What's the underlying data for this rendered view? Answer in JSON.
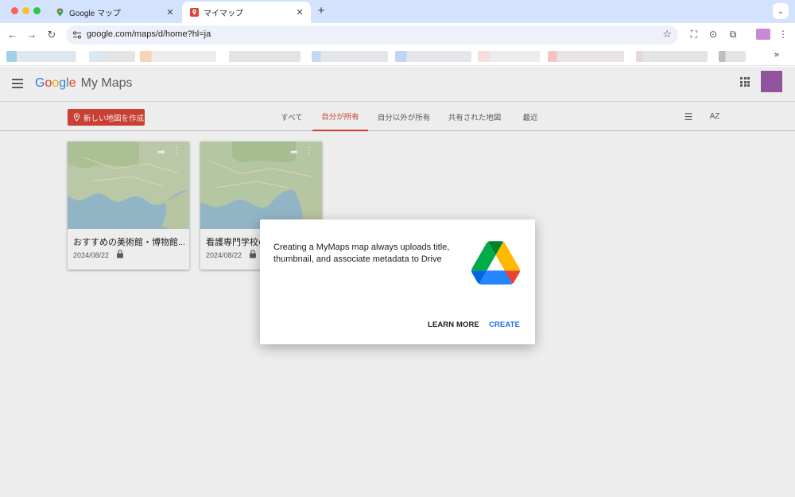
{
  "browser": {
    "tabs": [
      {
        "title": "Google マップ",
        "close": "✕"
      },
      {
        "title": "マイマップ",
        "close": "✕"
      }
    ],
    "new_tab": "+",
    "tab_menu": "⌄",
    "url": "google.com/maps/d/home?hl=ja",
    "bookmarks_more": "»"
  },
  "app": {
    "logo": {
      "g1": "G",
      "g2": "o",
      "g3": "o",
      "g4": "g",
      "g5": "l",
      "g6": "e",
      "product": "My Maps"
    },
    "create_button": "新しい地図を作成",
    "tabs": [
      "すべて",
      "自分が所有",
      "自分以外が所有",
      "共有された地図",
      "最近"
    ],
    "active_tab": "自分が所有",
    "sort_icon": "AZ"
  },
  "maps": [
    {
      "title": "おすすめの美術館・博物館...",
      "date": "2024/08/22"
    },
    {
      "title": "看護専門学校の",
      "date": "2024/08/22"
    }
  ],
  "dialog": {
    "message": "Creating a MyMaps map always uploads title, thumbnail, and associate metadata to Drive",
    "learn_more": "LEARN MORE",
    "create": "CREATE"
  },
  "colors": {
    "accent_red": "#db4437",
    "link_blue": "#1a73e8",
    "tabbar": "#d3e3fd"
  }
}
